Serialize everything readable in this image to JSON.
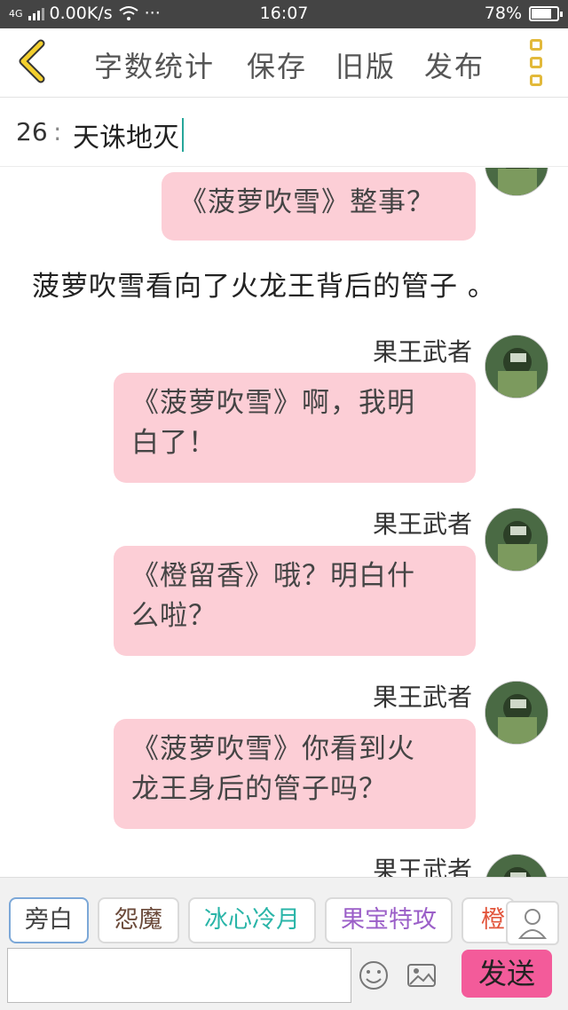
{
  "status_bar": {
    "network": "4G",
    "speed": "0.00K/s",
    "dots": "···",
    "time": "16:07",
    "battery": "78%",
    "battery_level": 0.78
  },
  "toolbar": {
    "word_count": "字数统计",
    "save": "保存",
    "old_version": "旧版",
    "publish": "发布"
  },
  "chapter": {
    "number": "26",
    "separator": ":",
    "title": "天诛地灭"
  },
  "messages": [
    {
      "type": "bubble",
      "text": "《菠萝吹雪》整事？"
    },
    {
      "type": "narration",
      "text": "菠萝吹雪看向了火龙王背后的管子 。"
    },
    {
      "type": "bubble",
      "speaker": "果王武者",
      "line1": "《菠萝吹雪》啊，我明",
      "line2": "白了！"
    },
    {
      "type": "bubble",
      "speaker": "果王武者",
      "line1": "《橙留香》哦？明白什",
      "line2": "么啦？"
    },
    {
      "type": "bubble",
      "speaker": "果王武者",
      "line1": "《菠萝吹雪》你看到火",
      "line2": "龙王身后的管子吗？"
    },
    {
      "type": "speaker",
      "speaker": "果王武者"
    }
  ],
  "characters": [
    {
      "name": "旁白",
      "color": "#444444",
      "active": true
    },
    {
      "name": "怨魔",
      "color": "#6b4a3a",
      "active": false
    },
    {
      "name": "冰心冷月",
      "color": "#2ab5a8",
      "active": false
    },
    {
      "name": "果宝特攻",
      "color": "#9b5fc8",
      "active": false
    },
    {
      "name": "橙",
      "color": "#e2553c",
      "active": false
    }
  ],
  "input": {
    "value": "",
    "placeholder": "",
    "send": "发送"
  },
  "colors": {
    "bubble": "#fcced6",
    "send_button": "#f35b9a",
    "menu_accent": "#e2b93a"
  }
}
